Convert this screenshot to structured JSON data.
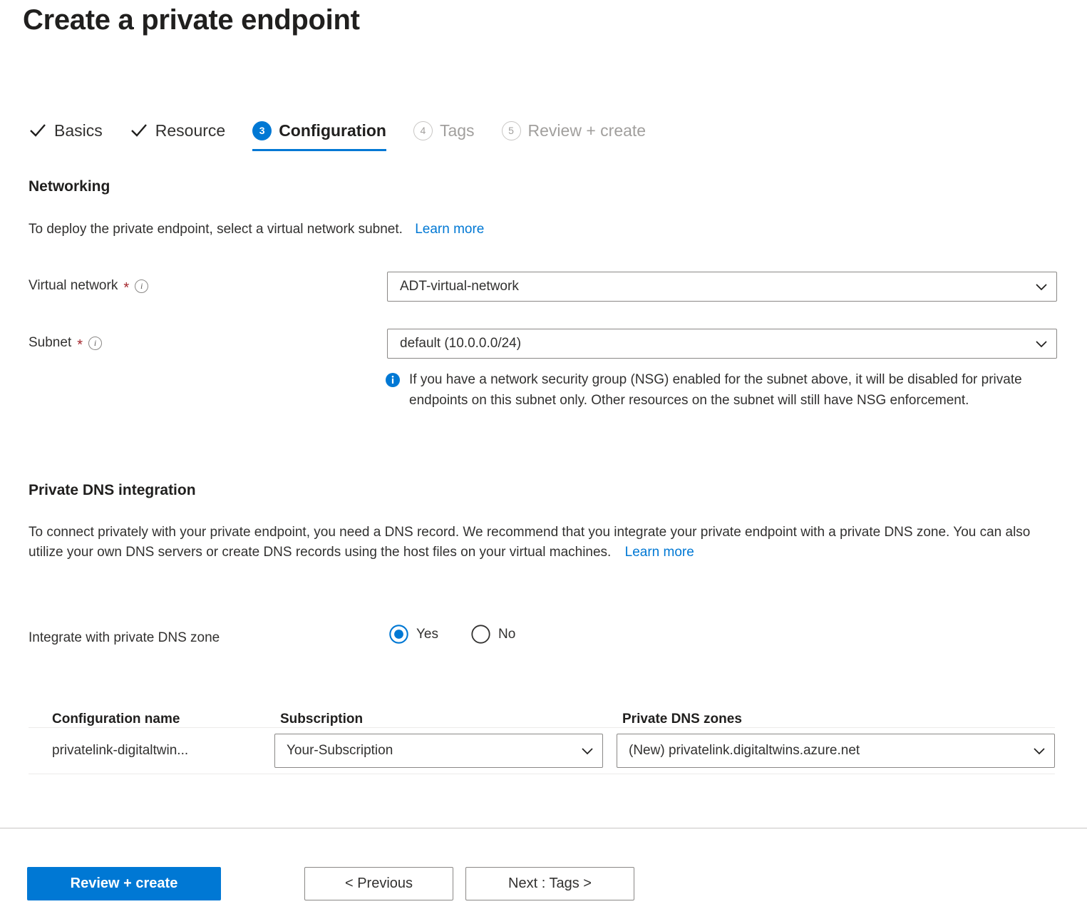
{
  "page": {
    "title": "Create a private endpoint"
  },
  "wizard": {
    "tabs": [
      {
        "label": "Basics",
        "state": "done",
        "marker": "check"
      },
      {
        "label": "Resource",
        "state": "done",
        "marker": "check"
      },
      {
        "label": "Configuration",
        "state": "current",
        "marker": "3"
      },
      {
        "label": "Tags",
        "state": "pending",
        "marker": "4"
      },
      {
        "label": "Review + create",
        "state": "pending",
        "marker": "5"
      }
    ]
  },
  "networking": {
    "heading": "Networking",
    "description": "To deploy the private endpoint, select a virtual network subnet.",
    "learn_more": "Learn more",
    "virtual_network": {
      "label": "Virtual network",
      "required_mark": "*",
      "value": "ADT-virtual-network"
    },
    "subnet": {
      "label": "Subnet",
      "required_mark": "*",
      "value": "default (10.0.0.0/24)"
    },
    "nsg_note": "If you have a network security group (NSG) enabled for the subnet above, it will be disabled for private endpoints on this subnet only. Other resources on the subnet will still have NSG enforcement."
  },
  "dns": {
    "heading": "Private DNS integration",
    "description": "To connect privately with your private endpoint, you need a DNS record. We recommend that you integrate your private endpoint with a private DNS zone. You can also utilize your own DNS servers or create DNS records using the host files on your virtual machines.",
    "learn_more": "Learn more",
    "integrate_label": "Integrate with private DNS zone",
    "options": [
      {
        "label": "Yes",
        "selected": true
      },
      {
        "label": "No",
        "selected": false
      }
    ],
    "table": {
      "columns": [
        "Configuration name",
        "Subscription",
        "Private DNS zones"
      ],
      "rows": [
        {
          "configuration_name": "privatelink-digitaltwin...",
          "subscription": "Your-Subscription",
          "private_dns_zone": "(New) privatelink.digitaltwins.azure.net"
        }
      ]
    }
  },
  "footer": {
    "review_create": "Review + create",
    "previous": "< Previous",
    "next": "Next : Tags >"
  },
  "colors": {
    "accent": "#0078d4",
    "required": "#a4262c",
    "text": "#323130",
    "muted": "#a19f9d",
    "border": "#8a8886"
  }
}
